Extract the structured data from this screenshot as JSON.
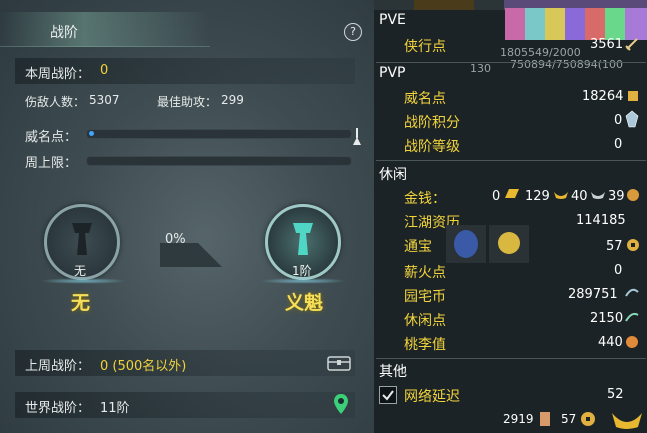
{
  "left_panel": {
    "title": "战阶",
    "help": "?",
    "weekly_rank_label": "本周战阶：",
    "weekly_rank_value": "0",
    "injured_label": "伤敌人数：",
    "injured_value": "5307",
    "assist_label": "最佳助攻：",
    "assist_value": "299",
    "prestige_label": "威名点：",
    "cap_label": "周上限：",
    "current_rank_small": "无",
    "current_rank_big": "无",
    "progress_pct": "0%",
    "next_rank_small": "1阶",
    "next_rank_big": "义魁",
    "last_week_label": "上周战阶：",
    "last_week_value": "0 (500名以外)",
    "world_label": "世界战阶：",
    "world_value": "11阶"
  },
  "right_panel": {
    "pve_header": "PVE",
    "pve_items": [
      {
        "label": "侠行点",
        "value": "3561"
      }
    ],
    "pvp_header": "PVP",
    "pvp_items": [
      {
        "label": "威名点",
        "value": "18264"
      },
      {
        "label": "战阶积分",
        "value": "0"
      },
      {
        "label": "战阶等级",
        "value": "0"
      }
    ],
    "leisure_header": "休闲",
    "money_label": "金钱：",
    "money": {
      "a": "0",
      "b": "129",
      "c": "40",
      "d": "39"
    },
    "leisure_items": [
      {
        "label": "江湖资历",
        "value": "114185"
      },
      {
        "label": "通宝",
        "value": "57"
      },
      {
        "label": "薪火点",
        "value": "0"
      },
      {
        "label": "园宅币",
        "value": "289751"
      },
      {
        "label": "休闲点",
        "value": "2150"
      },
      {
        "label": "桃李值",
        "value": "440"
      }
    ],
    "other_header": "其他",
    "latency_label": "网络延迟",
    "latency_value": "52",
    "bg_text_1": "1805549/2000",
    "bg_text_2": "750894/750894(100",
    "bg_text_3": "130",
    "bottom_a": "2919",
    "bottom_b": "57"
  },
  "colors": {
    "accent_yellow": "#f2d33a",
    "bar_blue": "#3fa6ff",
    "panel_bg": "#1b2326"
  }
}
